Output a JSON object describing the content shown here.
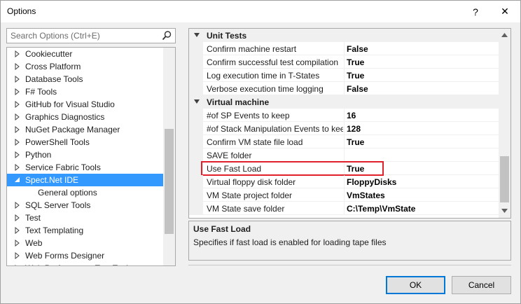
{
  "window": {
    "title": "Options",
    "help_symbol": "?",
    "close_symbol": "✕"
  },
  "search": {
    "placeholder": "Search Options (Ctrl+E)"
  },
  "tree": {
    "items": [
      {
        "label": "Cookiecutter",
        "expandable": true
      },
      {
        "label": "Cross Platform",
        "expandable": true
      },
      {
        "label": "Database Tools",
        "expandable": true
      },
      {
        "label": "F# Tools",
        "expandable": true
      },
      {
        "label": "GitHub for Visual Studio",
        "expandable": true
      },
      {
        "label": "Graphics Diagnostics",
        "expandable": true
      },
      {
        "label": "NuGet Package Manager",
        "expandable": true
      },
      {
        "label": "PowerShell Tools",
        "expandable": true
      },
      {
        "label": "Python",
        "expandable": true
      },
      {
        "label": "Service Fabric Tools",
        "expandable": true
      },
      {
        "label": "Spect.Net IDE",
        "expanded": true,
        "selected": true
      },
      {
        "label": "General options",
        "child": true
      },
      {
        "label": "SQL Server Tools",
        "expandable": true
      },
      {
        "label": "Test",
        "expandable": true
      },
      {
        "label": "Text Templating",
        "expandable": true
      },
      {
        "label": "Web",
        "expandable": true
      },
      {
        "label": "Web Forms Designer",
        "expandable": true
      },
      {
        "label": "Web Performance Test Tools",
        "expandable": true
      }
    ]
  },
  "grid": {
    "categories": [
      {
        "name": "Unit Tests",
        "properties": [
          {
            "name": "Confirm machine restart",
            "value": "False"
          },
          {
            "name": "Confirm successful test compilation",
            "value": "True"
          },
          {
            "name": "Log execution time in T-States",
            "value": "True"
          },
          {
            "name": "Verbose execution time logging",
            "value": "False"
          }
        ]
      },
      {
        "name": "Virtual machine",
        "properties": [
          {
            "name": "#of SP Events to keep",
            "value": "16"
          },
          {
            "name": "#of Stack Manipulation Events to keep",
            "value": "128"
          },
          {
            "name": "Confirm VM state file load",
            "value": "True"
          },
          {
            "name": "SAVE folder",
            "value": ""
          },
          {
            "name": "Use Fast Load",
            "value": "True",
            "highlighted": true
          },
          {
            "name": "Virtual floppy disk folder",
            "value": "FloppyDisks"
          },
          {
            "name": "VM State project folder",
            "value": "VmStates"
          },
          {
            "name": "VM State save folder",
            "value": "C:\\Temp\\VmState"
          }
        ]
      }
    ]
  },
  "description": {
    "title": "Use Fast Load",
    "text": "Specifies if fast load is enabled for loading tape files"
  },
  "buttons": {
    "ok": "OK",
    "cancel": "Cancel"
  },
  "colors": {
    "selection": "#3399ff",
    "highlight_border": "#e0202a",
    "default_button_border": "#0078d7"
  }
}
